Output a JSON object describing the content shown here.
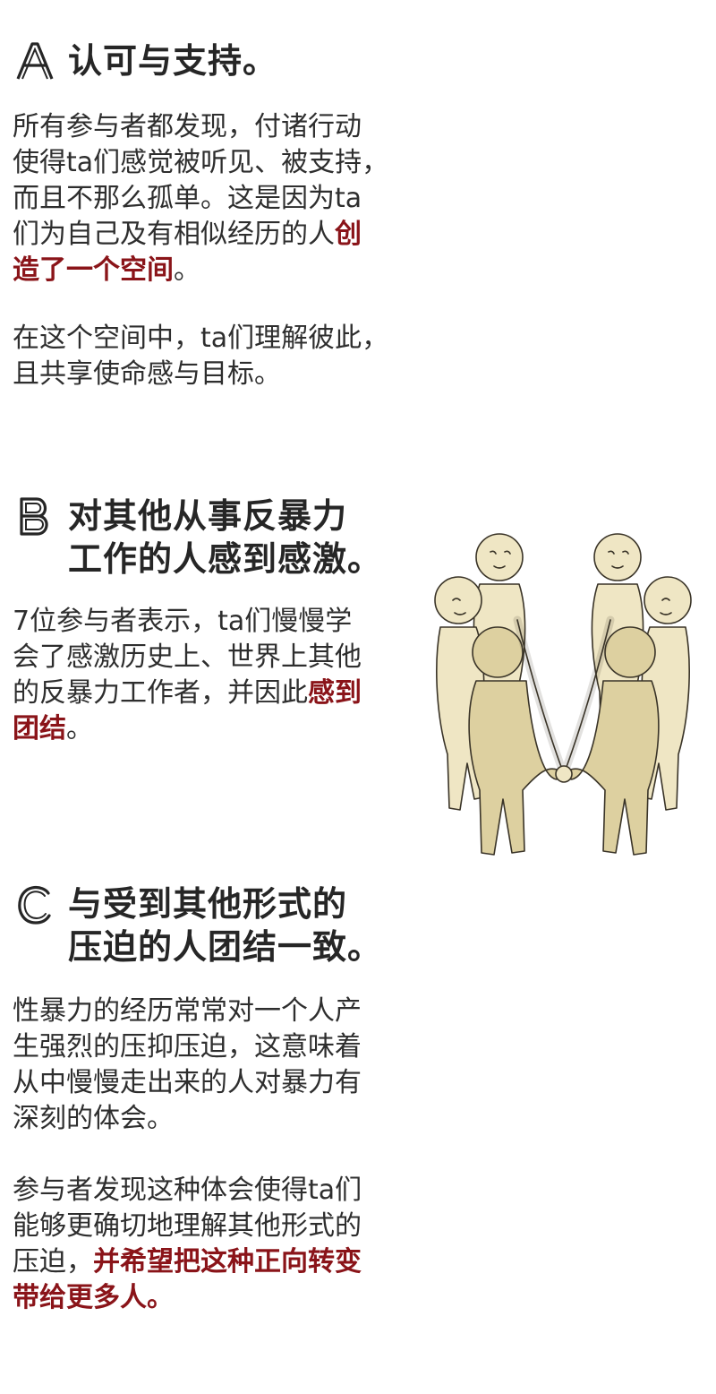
{
  "sections": [
    {
      "letter": "A",
      "heading_lines": [
        "认可与支持。"
      ],
      "paragraphs": [
        {
          "lines": [
            [
              "所有参与者都发现，付诸行动"
            ],
            [
              "使得ta们感觉被听见、被支持，"
            ],
            [
              "而且不那么孤单。这是因为ta"
            ],
            [
              "们为自己及有相似经历的人",
              "创"
            ],
            [
              "造了一个空间",
              "。"
            ]
          ]
        },
        {
          "lines": [
            [
              "在这个空间中，ta们理解彼此，"
            ],
            [
              "且共享使命感与目标。"
            ]
          ]
        }
      ]
    },
    {
      "letter": "B",
      "heading_lines": [
        "对其他从事反暴力",
        "工作的人感到感激。"
      ],
      "paragraphs": [
        {
          "lines": [
            [
              "7位参与者表示，ta们慢慢学"
            ],
            [
              "会了感激历史上、世界上其他"
            ],
            [
              "的反暴力工作者，并因此",
              "感到"
            ],
            [
              "团结",
              "。"
            ]
          ]
        }
      ]
    },
    {
      "letter": "C",
      "heading_lines": [
        "与受到其他形式的",
        "压迫的人团结一致。"
      ],
      "paragraphs": [
        {
          "lines": [
            [
              "性暴力的经历常常对一个人产"
            ],
            [
              "生强烈的压抑压迫，这意味着"
            ],
            [
              "从中慢慢走出来的人对暴力有"
            ],
            [
              "深刻的体会。"
            ]
          ]
        },
        {
          "lines": [
            [
              "参与者发现这种体会使得ta们"
            ],
            [
              "能够更确切地理解其他形式的"
            ],
            [
              "压迫，",
              "并希望把这种正向转变"
            ],
            [
              "带给更多人。"
            ]
          ]
        }
      ]
    }
  ],
  "highlights": {
    "a_p1_l4": "创",
    "a_p1_l5": "造了一个空间",
    "b_p1_l3": "感到",
    "b_p1_l4": "团结",
    "c_p2_l3": "并希望把这种正向转变",
    "c_p2_l4": "带给更多人。"
  },
  "illustration": {
    "name": "people-circle-holding-hands",
    "figure_color": "#efe6c4",
    "figure_shadow": "#d8c98f",
    "outline_color": "#3a3428"
  },
  "colors": {
    "heading": "#262626",
    "body_text": "#2e2e2e",
    "highlight": "#8a1419",
    "background": "#ffffff"
  }
}
